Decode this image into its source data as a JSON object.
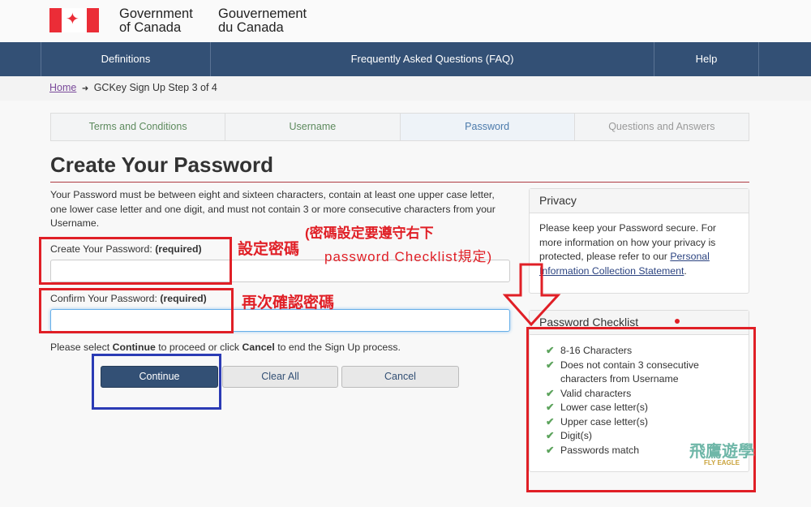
{
  "header": {
    "sig_en_1": "Government",
    "sig_en_2": "of Canada",
    "sig_fr_1": "Gouvernement",
    "sig_fr_2": "du Canada"
  },
  "nav": {
    "items": [
      "Definitions",
      "Frequently Asked Questions (FAQ)",
      "Help"
    ]
  },
  "breadcrumb": {
    "home": "Home",
    "arrow": "➜",
    "current": "GCKey Sign Up Step 3 of 4"
  },
  "steps": [
    "Terms and Conditions",
    "Username",
    "Password",
    "Questions and Answers"
  ],
  "page_title": "Create Your Password",
  "intro": "Your Password must be between eight and sixteen characters, contain at least one upper case letter, one lower case letter and one digit, and must not contain 3 or more consecutive characters from your Username.",
  "form": {
    "password_label": "Create Your Password:",
    "required": "(required)",
    "confirm_label": "Confirm Your Password:",
    "password_value": "",
    "confirm_value": "",
    "instr_1": "Please select ",
    "instr_continue": "Continue",
    "instr_2": " to proceed or click ",
    "instr_cancel": "Cancel",
    "instr_3": " to end the Sign Up process.",
    "continue": "Continue",
    "clear": "Clear All",
    "cancel": "Cancel"
  },
  "privacy": {
    "title": "Privacy",
    "text": "Please keep your Password secure. For more information on how your privacy is protected, please refer to our ",
    "link": "Personal Information Collection Statement",
    "end": "."
  },
  "checklist": {
    "title": "Password Checklist",
    "items": [
      "8-16 Characters",
      "Does not contain 3 consecutive characters from Username",
      "Valid characters",
      "Lower case letter(s)",
      "Upper case letter(s)",
      "Digit(s)",
      "Passwords match"
    ]
  },
  "annotations": {
    "set_pw": "設定密碼",
    "note_1": "(密碼設定要遵守右下",
    "note_2": "password Checklist規定)",
    "confirm_pw": "再次確認密碼"
  },
  "watermark": {
    "cn": "飛鷹遊學",
    "en": "FLY EAGLE"
  },
  "colors": {
    "nav": "#335075",
    "annotation_red": "#e01f26",
    "annotation_blue": "#2b3bb5",
    "check": "#5ca35c"
  }
}
